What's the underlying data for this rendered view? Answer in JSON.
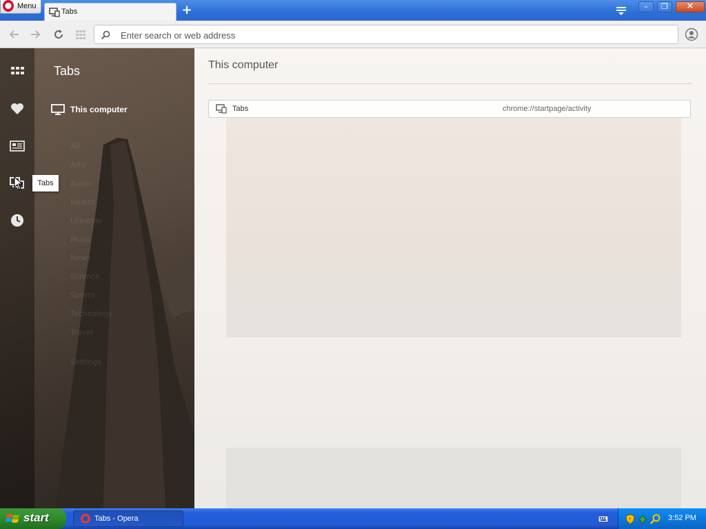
{
  "titlebar": {
    "menu_label": "Menu",
    "tab_title": "Tabs",
    "new_tab": "+",
    "min": "–",
    "max": "❐",
    "close": "✕"
  },
  "toolbar": {
    "address_placeholder": "Enter search or web address"
  },
  "sidebar": {
    "panel_title": "Tabs",
    "tooltip": "Tabs",
    "selected_item": "This computer",
    "faded_items": [
      "All",
      "Arts",
      "Autos",
      "Health",
      "Lifestyle",
      "Music",
      "News",
      "Science",
      "Sports",
      "Technology",
      "Travel",
      "Settings"
    ]
  },
  "main": {
    "section_title": "This computer",
    "tabs": [
      {
        "title": "Tabs",
        "url": "chrome://startpage/activity"
      }
    ]
  },
  "taskbar": {
    "start_label": "start",
    "task_title": "Tabs - Opera",
    "clock": "3:52 PM"
  },
  "colors": {
    "titlebar": "#2d6fd6",
    "taskbar": "#245edb",
    "start_green": "#2f8a2f",
    "tray_blue": "#0c74d8"
  }
}
